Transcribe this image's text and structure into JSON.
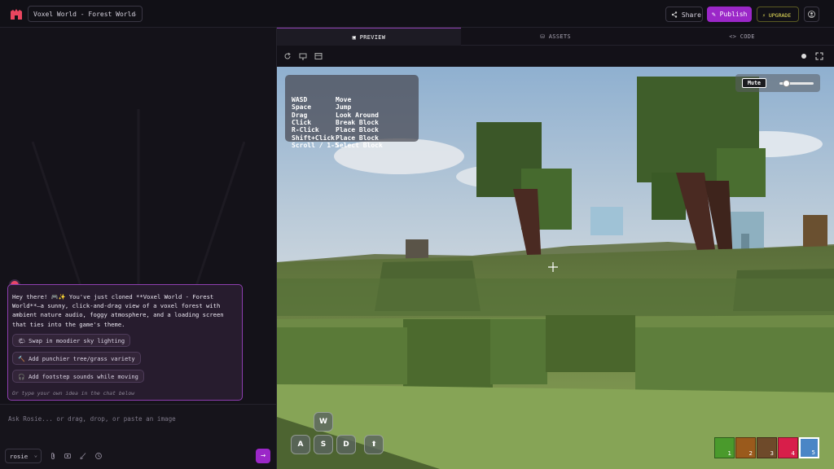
{
  "header": {
    "project_name": "Voxel World - Forest World",
    "share_label": "Share",
    "publish_label": "Publish",
    "upgrade_label": "UPGRADE"
  },
  "tabs": [
    {
      "label": "PREVIEW",
      "active": true
    },
    {
      "label": "ASSETS",
      "active": false
    },
    {
      "label": "CODE",
      "active": false
    }
  ],
  "chat": {
    "message": "Hey there! 🎮✨ You've just cloned **Voxel World - Forest World**—a sunny, click-and-drag view of a voxel forest with ambient nature audio, foggy atmosphere, and a loading screen that ties into the game's theme.",
    "suggestions": [
      {
        "icon": "🌤",
        "label": "Swap in moodier sky lighting"
      },
      {
        "icon": "🔨",
        "label": "Add punchier tree/grass variety"
      },
      {
        "icon": "🎧",
        "label": "Add footstep sounds while moving"
      }
    ],
    "hint": "Or type your own idea in the chat below",
    "input_placeholder": "Ask Rosie... or drag, drop, or paste an image",
    "model": "rosie"
  },
  "game": {
    "controls": [
      {
        "key": "WASD",
        "action": "Move"
      },
      {
        "key": "Space",
        "action": "Jump"
      },
      {
        "key": "Drag",
        "action": "Look Around"
      },
      {
        "key": "Click",
        "action": "Break Block"
      },
      {
        "key": "R-Click",
        "action": "Place Block"
      },
      {
        "key": "Shift+Click",
        "action": "Place Block"
      },
      {
        "key": "Scroll / 1-5",
        "action": "Select Block"
      }
    ],
    "mute_label": "Mute",
    "volume": 0.2,
    "keys": {
      "w": "W",
      "a": "A",
      "s": "S",
      "d": "D",
      "jump": "⬆"
    },
    "hotbar": [
      {
        "num": "1",
        "color": "#4a9a2c"
      },
      {
        "num": "2",
        "color": "#9a5a1c"
      },
      {
        "num": "3",
        "color": "#6e4a2a"
      },
      {
        "num": "4",
        "color": "#d81e4a"
      },
      {
        "num": "5",
        "color": "#4a86c6",
        "selected": true
      }
    ]
  },
  "colors": {
    "accent": "#9b27c8",
    "upgrade": "#e8e05a"
  }
}
